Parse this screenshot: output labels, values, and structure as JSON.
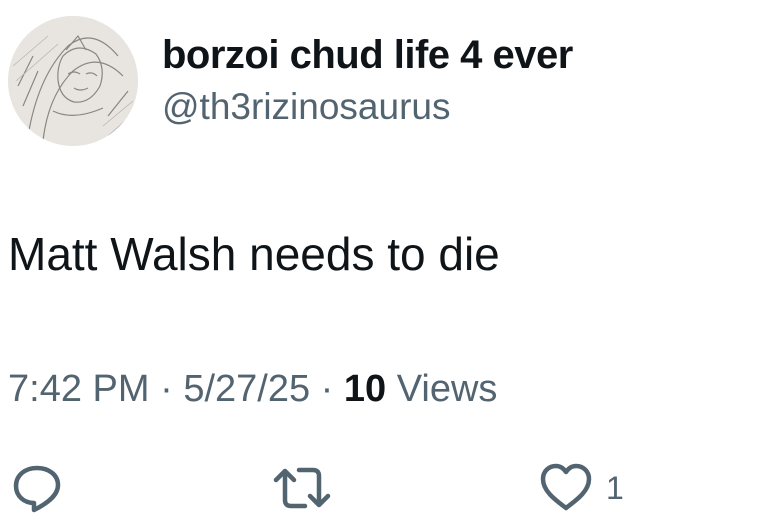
{
  "user": {
    "display_name": "borzoi chud life 4 ever",
    "handle": "@th3rizinosaurus",
    "avatar_icon": "sketch-avatar"
  },
  "tweet": {
    "text": "Matt Walsh needs to die",
    "time": "7:42 PM",
    "date": "5/27/25",
    "separator": "·",
    "views_count": "10",
    "views_label": "Views"
  },
  "actions": {
    "reply_icon": "reply-icon",
    "retweet_icon": "retweet-icon",
    "like_icon": "heart-icon",
    "like_count": "1"
  },
  "colors": {
    "text_primary": "#0f1419",
    "text_secondary": "#536471",
    "background": "#ffffff"
  }
}
